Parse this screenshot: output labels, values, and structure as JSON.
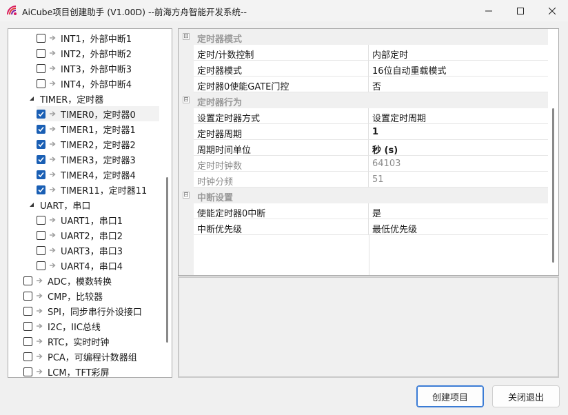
{
  "window": {
    "title": "AiCube项目创建助手 (V1.00D) --前海方舟智能开发系统--",
    "icon": "aicube-logo-icon",
    "controls": [
      "minimize-icon",
      "maximize-icon",
      "close-icon"
    ]
  },
  "tree": {
    "items": [
      {
        "label": "INT1，外部中断1",
        "checked": false
      },
      {
        "label": "INT2，外部中断2",
        "checked": false
      },
      {
        "label": "INT3，外部中断3",
        "checked": false
      },
      {
        "label": "INT4，外部中断4",
        "checked": false
      },
      {
        "label": "TIMER，定时器",
        "group": true,
        "expanded": true
      },
      {
        "label": "TIMER0，定时器0",
        "checked": true,
        "selected": true
      },
      {
        "label": "TIMER1，定时器1",
        "checked": true
      },
      {
        "label": "TIMER2，定时器2",
        "checked": true
      },
      {
        "label": "TIMER3，定时器3",
        "checked": true
      },
      {
        "label": "TIMER4，定时器4",
        "checked": true
      },
      {
        "label": "TIMER11，定时器11",
        "checked": true
      },
      {
        "label": "UART，串口",
        "group": true,
        "expanded": true
      },
      {
        "label": "UART1，串口1",
        "checked": false
      },
      {
        "label": "UART2，串口2",
        "checked": false
      },
      {
        "label": "UART3，串口3",
        "checked": false
      },
      {
        "label": "UART4，串口4",
        "checked": false
      },
      {
        "label": "ADC，模数转换",
        "checked": false
      },
      {
        "label": "CMP，比较器",
        "checked": false
      },
      {
        "label": "SPI，同步串行外设接口",
        "checked": false
      },
      {
        "label": "I2C，IIC总线",
        "checked": false
      },
      {
        "label": "RTC，实时时钟",
        "checked": false
      },
      {
        "label": "PCA，可编程计数器组",
        "checked": false
      },
      {
        "label": "LCM，TFT彩屏",
        "checked": false
      }
    ]
  },
  "properties": {
    "categories": [
      {
        "label": "定时器模式",
        "toggle": "⊟",
        "rows": [
          {
            "name": "定时/计数控制",
            "value": "内部定时"
          },
          {
            "name": "定时器模式",
            "value": "16位自动重载模式"
          },
          {
            "name": "定时器0使能GATE门控",
            "value": "否"
          }
        ]
      },
      {
        "label": "定时器行为",
        "toggle": "⊟",
        "rows": [
          {
            "name": "设置定时器方式",
            "value": "设置定时周期"
          },
          {
            "name": "定时器周期",
            "value": "1"
          },
          {
            "name": "周期时间单位",
            "value": "秒 (s)"
          },
          {
            "name": "定时时钟数",
            "value": "64103"
          },
          {
            "name": "时钟分频",
            "value": "51"
          }
        ]
      },
      {
        "label": "中断设置",
        "toggle": "⊟",
        "rows": [
          {
            "name": "使能定时器0中断",
            "value": "是"
          },
          {
            "name": "中断优先级",
            "value": "最低优先级"
          }
        ]
      }
    ]
  },
  "buttons": {
    "create": "创建项目",
    "close": "关闭退出"
  },
  "colors": {
    "accent": "#1a5fb4",
    "primary_border": "#3a7bd5"
  }
}
